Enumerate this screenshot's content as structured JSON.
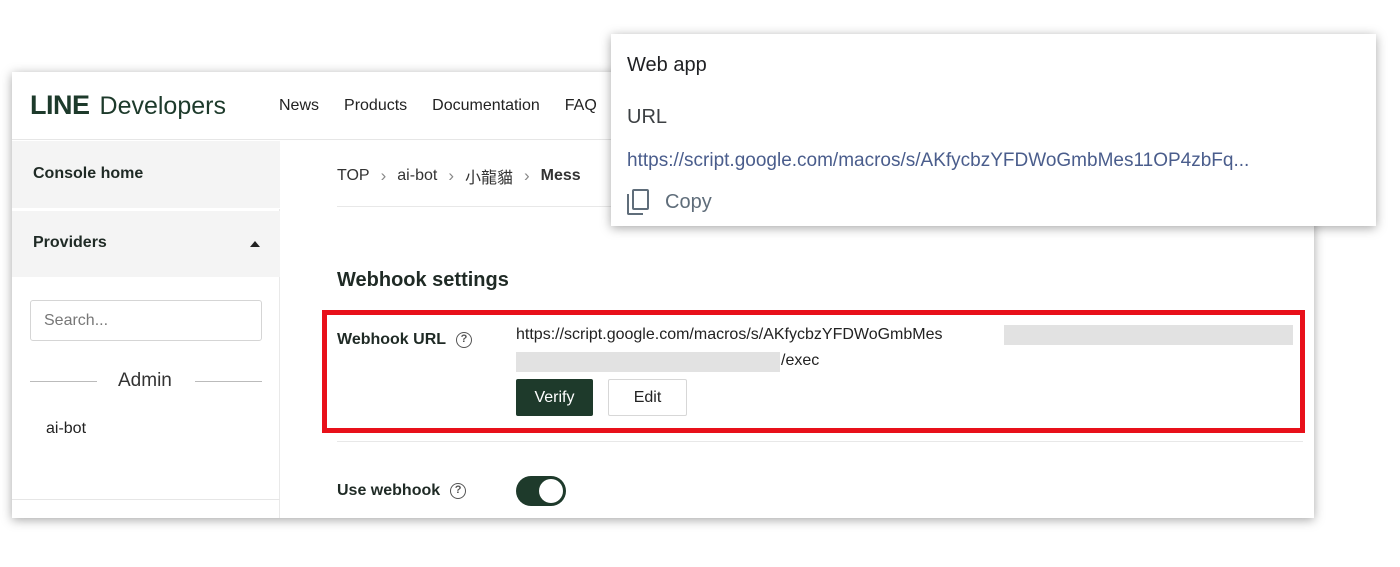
{
  "header": {
    "logo_brand": "LINE",
    "logo_product": "Developers",
    "nav": [
      "News",
      "Products",
      "Documentation",
      "FAQ"
    ]
  },
  "sidebar": {
    "console_home": "Console home",
    "providers": "Providers",
    "search_placeholder": "Search...",
    "group_label": "Admin",
    "provider_item": "ai-bot"
  },
  "breadcrumb": {
    "items": [
      "TOP",
      "ai-bot",
      "小龍貓",
      "Mess"
    ]
  },
  "webhook": {
    "section_title": "Webhook settings",
    "url_label": "Webhook URL",
    "help_glyph": "?",
    "url_visible_start": "https://script.google.com/macros/s/AKfycbzYFDWoGmbMes",
    "url_visible_end": "/exec",
    "verify_label": "Verify",
    "edit_label": "Edit",
    "use_webhook_label": "Use webhook",
    "use_webhook_enabled": true
  },
  "popup": {
    "title": "Web app",
    "url_label": "URL",
    "url_value": "https://script.google.com/macros/s/AKfycbzYFDWoGmbMes11OP4zbFq...",
    "copy_label": "Copy"
  },
  "colors": {
    "brand_dark_green": "#1e3a2b",
    "highlight_red": "#e8101a",
    "link_blue": "#4a5d8c"
  },
  "icons": [
    "help-icon",
    "caret-up-icon",
    "copy-icon"
  ]
}
